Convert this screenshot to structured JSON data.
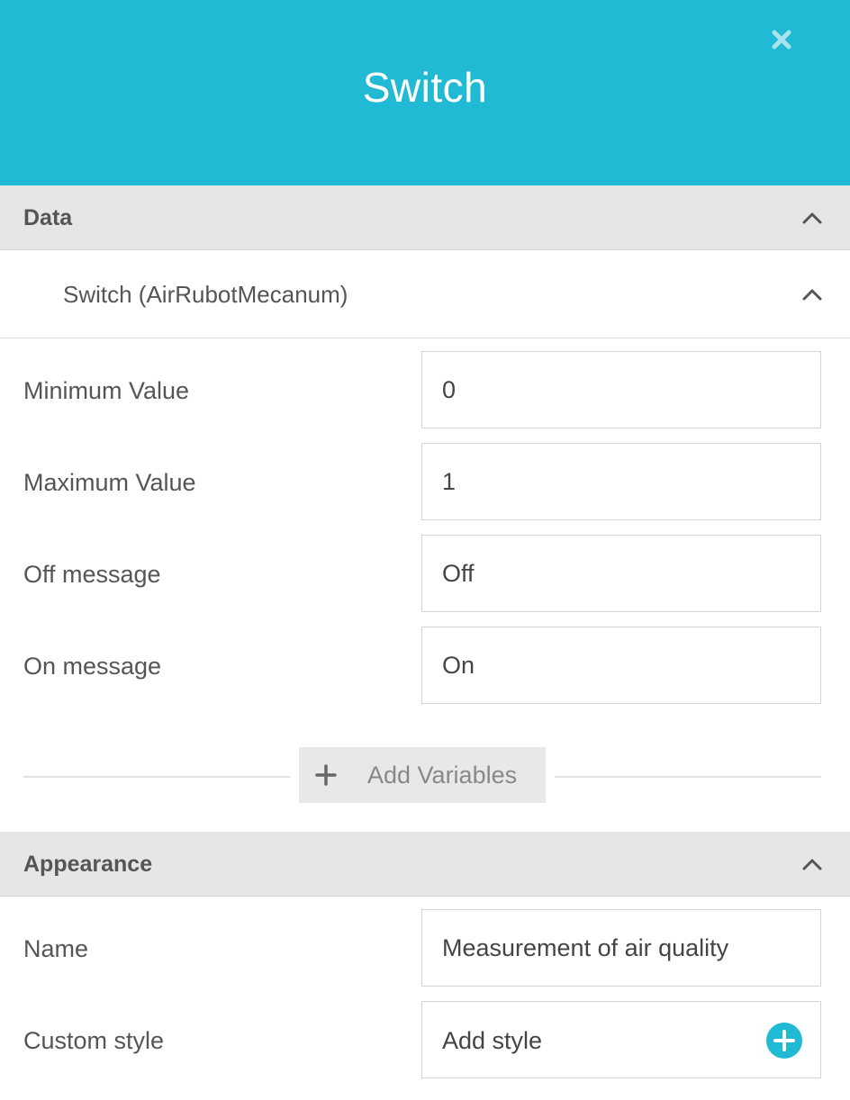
{
  "header": {
    "title": "Switch",
    "close_icon": "close-icon"
  },
  "colors": {
    "header_bg": "#20bad5",
    "section_bg": "#e6e6e6",
    "accent": "#20bad5"
  },
  "data_section": {
    "title": "Data",
    "variable": {
      "title": "Switch (AirRubotMecanum)"
    },
    "fields": {
      "min": {
        "label": "Minimum Value",
        "value": "0"
      },
      "max": {
        "label": "Maximum Value",
        "value": "1"
      },
      "off": {
        "label": "Off message",
        "value": "Off"
      },
      "on": {
        "label": "On message",
        "value": "On"
      }
    },
    "add_variables_label": "Add Variables"
  },
  "appearance_section": {
    "title": "Appearance",
    "fields": {
      "name": {
        "label": "Name",
        "value": "Measurement of air quality"
      },
      "custom_style": {
        "label": "Custom style",
        "button_label": "Add style"
      }
    }
  }
}
